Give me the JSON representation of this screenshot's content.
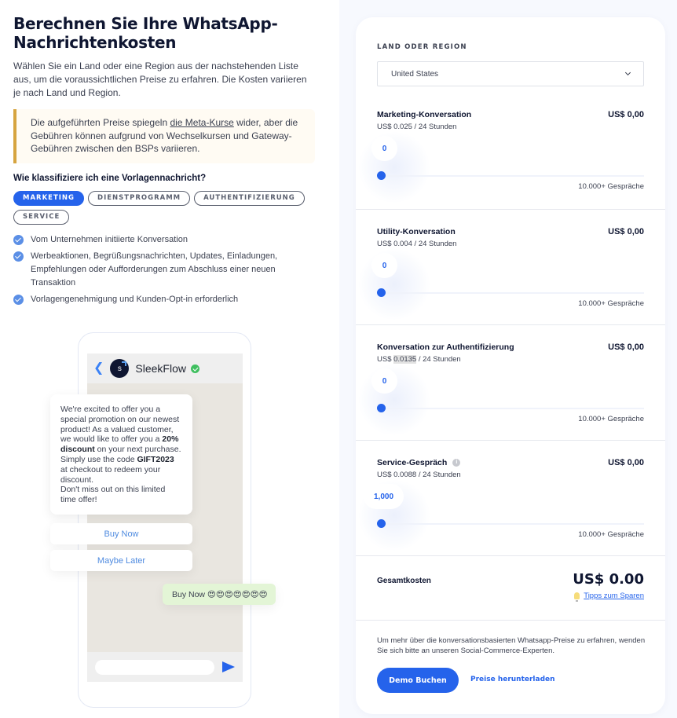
{
  "left": {
    "title": "Berechnen Sie Ihre WhatsApp-Nachrichtenkosten",
    "intro": "Wählen Sie ein Land oder eine Region aus der nachstehenden Liste aus, um die voraussichtlichen Preise zu erfahren. Die Kosten variieren je nach Land und Region.",
    "notice": {
      "before": "Die aufgeführten Preise spiegeln ",
      "link": "die Meta-Kurse",
      "after": " wider, aber die Gebühren können aufgrund von Wechselkursen und Gateway-Gebühren zwischen den BSPs variieren."
    },
    "question": "Wie klassifiziere ich eine Vorlagennachricht?",
    "chips": [
      {
        "label": "MARKETING",
        "active": true
      },
      {
        "label": "DIENSTPROGRAMM",
        "active": false
      },
      {
        "label": "AUTHENTIFIZIERUNG",
        "active": false
      },
      {
        "label": "SERVICE",
        "active": false
      }
    ],
    "checks": [
      "Vom Unternehmen initiierte Konversation",
      "Werbeaktionen, Begrüßungsnachrichten, Updates, Einladungen, Empfehlungen oder Aufforderungen zum Abschluss einer neuen Transaktion",
      "Vorlagengenehmigung und Kunden-Opt-in erforderlich"
    ]
  },
  "phone": {
    "brand": "SleekFlow",
    "avatar_letter": "s",
    "message": {
      "p1": "We're excited to offer you a special promotion on our newest product! As a valued customer, we would like to offer you a ",
      "b1": "20% discount",
      "p2": " on your next purchase. Simply use the code ",
      "b2": "GIFT2023",
      "p3": " at checkout to redeem your discount.",
      "p4": "Don't miss out on this limited time offer!"
    },
    "quick_replies": [
      "Buy Now",
      "Maybe Later"
    ],
    "reply": "Buy Now 😍😍😍😍😍😍😍"
  },
  "calculator": {
    "region_label": "LAND ODER REGION",
    "region_value": "United States",
    "max_label": "10.000+ Gespräche",
    "sections": [
      {
        "name": "Marketing-Konversation",
        "cost": "US$ 0,00",
        "rate_prefix": "US$ ",
        "rate_value": "0.025",
        "rate_suffix": " / 24 Stunden",
        "slider_value": "0",
        "slider_fraction": 0,
        "info": false,
        "highlight": false
      },
      {
        "name": "Utility-Konversation",
        "cost": "US$ 0,00",
        "rate_prefix": "US$ ",
        "rate_value": "0.004",
        "rate_suffix": " / 24 Stunden",
        "slider_value": "0",
        "slider_fraction": 0,
        "info": false,
        "highlight": false
      },
      {
        "name": "Konversation zur Authentifizierung",
        "cost": "US$ 0,00",
        "rate_prefix": "US$ ",
        "rate_value": "0.0135",
        "rate_suffix": " / 24 Stunden",
        "slider_value": "0",
        "slider_fraction": 0,
        "info": false,
        "highlight": true
      },
      {
        "name": "Service-Gespräch",
        "cost": "US$ 0,00",
        "rate_prefix": "US$ ",
        "rate_value": "0.0088",
        "rate_suffix": " / 24 Stunden",
        "slider_value": "1,000",
        "slider_fraction": 0,
        "info": true,
        "highlight": false
      }
    ],
    "total_label": "Gesamtkosten",
    "total_value": "US$ 0.00",
    "tips_label": "Tipps zum Sparen",
    "cta_text": "Um mehr über die konversationsbasierten Whatsapp-Preise zu erfahren, wenden Sie sich bitte an unseren Social-Commerce-Experten.",
    "demo_button": "Demo Buchen",
    "download_link": "Preise herunterladen"
  },
  "colors": {
    "accent": "#2563eb",
    "notice_border": "#d6a43f",
    "text_dark": "#0f1631",
    "reply_bubble": "#e3f5d6"
  }
}
